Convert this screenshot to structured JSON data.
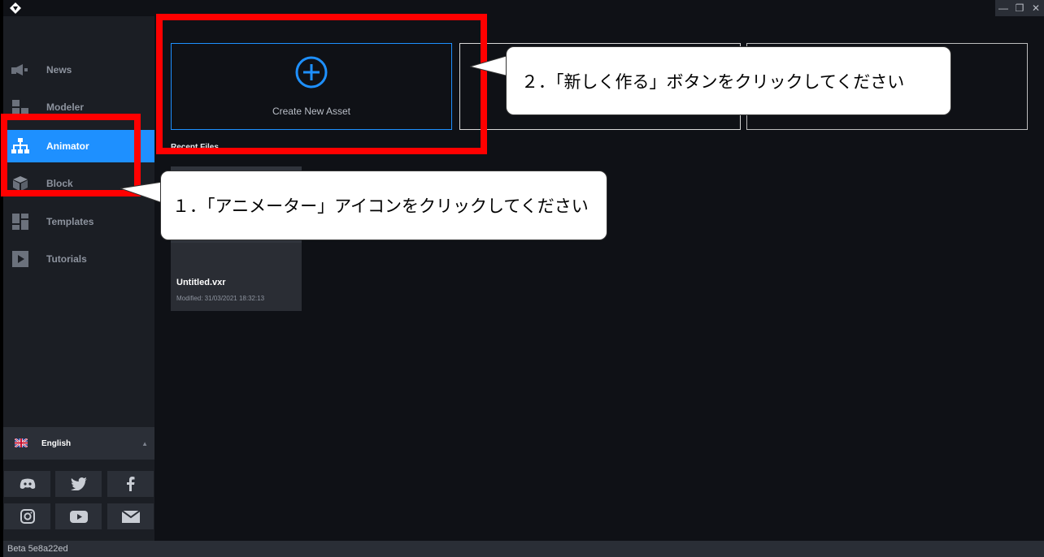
{
  "window": {
    "minimize_glyph": "—",
    "restore_glyph": "❐",
    "close_glyph": "✕"
  },
  "sidebar": {
    "items": [
      {
        "label": "News",
        "icon": "megaphone-icon",
        "active": false
      },
      {
        "label": "Modeler",
        "icon": "modeler-icon",
        "active": false
      },
      {
        "label": "Animator",
        "icon": "hierarchy-icon",
        "active": true
      },
      {
        "label": "Block",
        "icon": "cube-icon",
        "active": false
      },
      {
        "label": "Templates",
        "icon": "templates-icon",
        "active": false
      },
      {
        "label": "Tutorials",
        "icon": "play-icon",
        "active": false
      }
    ],
    "language": {
      "label": "English",
      "flag": "uk-flag-icon"
    },
    "social": [
      "discord-icon",
      "twitter-icon",
      "facebook-icon",
      "instagram-icon",
      "youtube-icon",
      "mail-icon"
    ]
  },
  "main": {
    "create_asset_label": "Create New Asset",
    "recent_title": "Recent Files",
    "recent_files": [
      {
        "name": "Untitled.vxr",
        "modified": "Modified: 31/03/2021 18:32:13"
      }
    ]
  },
  "status": {
    "text": "Beta 5e8a22ed"
  },
  "annotations": {
    "step1": "１．「アニメーター」アイコンをクリックしてください",
    "step2": "２．「新しく作る」ボタンをクリックしてください"
  },
  "colors": {
    "accent": "#1e90ff",
    "annotation_red": "#ff0000"
  }
}
